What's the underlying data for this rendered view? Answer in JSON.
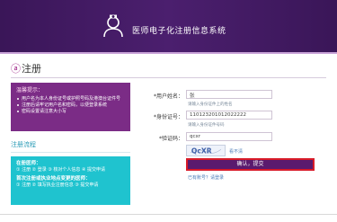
{
  "header": {
    "site_title": "医师电子化注册信息系统",
    "background": "#3a1658"
  },
  "page": {
    "title_icon": "ⓐ",
    "title": "注册"
  },
  "tips": {
    "title": "温馨提示：",
    "items": [
      "用户名为本人身份证号或护照号码及港澳台证件号",
      "注册后请牢记用户名和密码，以便登录系统",
      "密码设置请注意大小写"
    ]
  },
  "notice": {
    "title": "注册流程",
    "line1_bold": "在册医师：",
    "line1": "① 注册 ② 登录 ③ 核对个人信息 ④ 提交申请",
    "line2_bold": "首次注册或执业地点变更的医师：",
    "line2": "① 注册 ② 填写执业注册信息 ③ 提交申请"
  },
  "form": {
    "username_label": "*用户姓名：",
    "username_value": "张",
    "username_hint": "请输入身份证件上的姓名",
    "id_label": "*身份证号：",
    "id_value": "110123201012022222",
    "id_hint": "请输入身份证件号码",
    "captcha_label": "*验证码：",
    "captcha_value": "qcxr",
    "captcha_text": "QcXR",
    "captcha_refresh": "看不清",
    "submit_label": "确认，提交",
    "login_link": "已有账号？请登录"
  },
  "colors": {
    "tips_bg": "#7b2c86",
    "notice_bg": "#1fc3cf",
    "button_bg": "#5a1a6e",
    "button_border": "#d81a28"
  }
}
